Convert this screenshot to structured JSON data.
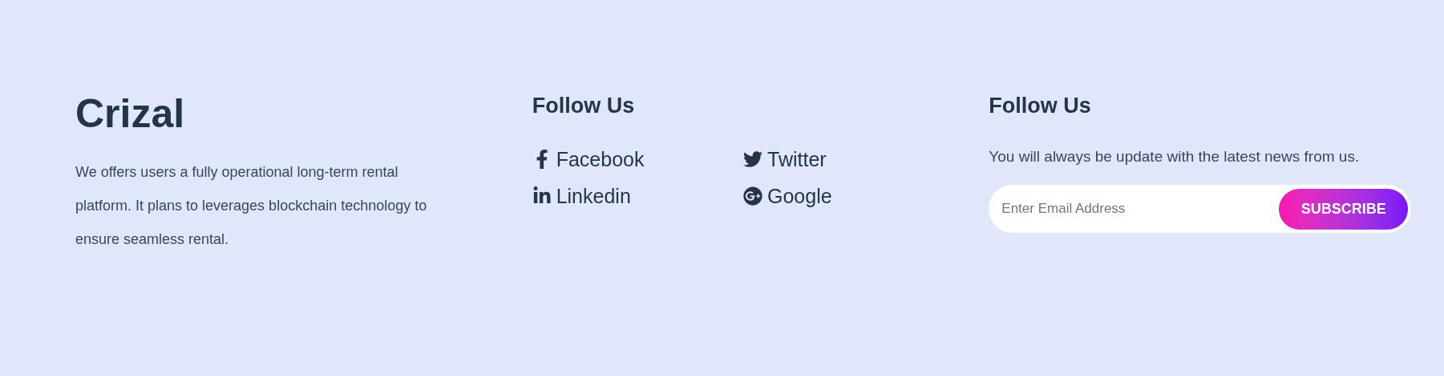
{
  "brand": {
    "name": "Crizal",
    "description": "We offers users a fully operational long-term rental platform. It plans to leverages blockchain technology to ensure seamless rental."
  },
  "social": {
    "heading": "Follow Us",
    "links": [
      {
        "kind": "facebook",
        "label": "Facebook"
      },
      {
        "kind": "twitter",
        "label": "Twitter"
      },
      {
        "kind": "linkedin",
        "label": "Linkedin"
      },
      {
        "kind": "google",
        "label": "Google"
      }
    ]
  },
  "newsletter": {
    "heading": "Follow Us",
    "text": "You will always be update with the latest news from us.",
    "placeholder": "Enter Email Address",
    "button": "SUBSCRIBE"
  }
}
